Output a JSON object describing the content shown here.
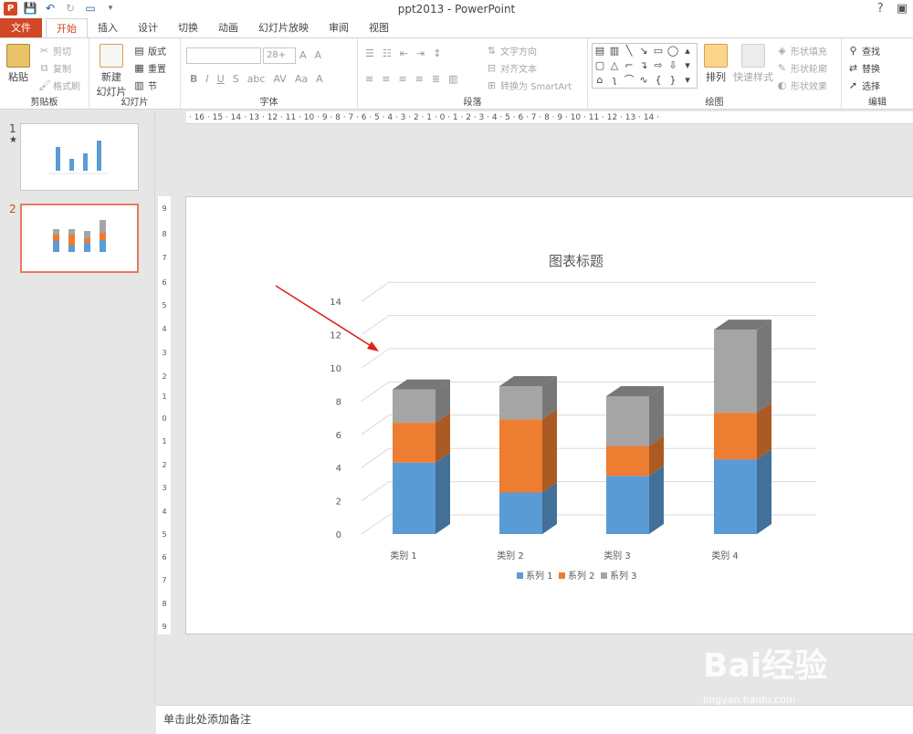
{
  "title_bar": {
    "app_title": "ppt2013 - PowerPoint",
    "logo_letter": "P",
    "help": "?"
  },
  "tabs": [
    "文件",
    "开始",
    "插入",
    "设计",
    "切换",
    "动画",
    "幻灯片放映",
    "审阅",
    "视图"
  ],
  "ribbon": {
    "clipboard": {
      "label": "剪贴板",
      "paste": "粘贴",
      "cut": "剪切",
      "copy": "复制",
      "format_painter": "格式刷"
    },
    "slides": {
      "label": "幻灯片",
      "new_slide_1": "新建",
      "new_slide_2": "幻灯片",
      "layout": "版式",
      "reset": "重置",
      "section": "节"
    },
    "font": {
      "label": "字体",
      "size": "28+"
    },
    "paragraph": {
      "label": "段落",
      "text_direction": "文字方向",
      "align_text": "对齐文本",
      "smartart": "转换为 SmartArt"
    },
    "drawing": {
      "label": "绘图",
      "arrange": "排列",
      "quick_styles": "快速样式",
      "shape_fill": "形状填充",
      "shape_outline": "形状轮廓",
      "shape_effects": "形状效果"
    },
    "editing": {
      "label": "编辑",
      "find": "查找",
      "replace": "替换",
      "select": "选择"
    }
  },
  "thumbnails": [
    {
      "number": "1",
      "marker": "★"
    },
    {
      "number": "2",
      "marker": ""
    }
  ],
  "notes_placeholder": "单击此处添加备注",
  "watermark": {
    "brand": "Bai",
    "brand_cn": "经验",
    "url": "jingyan.baidu.com"
  },
  "colors": {
    "accent": "#d24726",
    "series1": "#5b9bd5",
    "series2": "#ed7d31",
    "series3": "#a5a5a5",
    "arrow": "#e0201b"
  },
  "chart_data": {
    "type": "bar",
    "stacked": true,
    "three_d": true,
    "title": "图表标题",
    "categories": [
      "类别 1",
      "类别 2",
      "类别 3",
      "类别 4"
    ],
    "series": [
      {
        "name": "系列 1",
        "values": [
          4.3,
          2.5,
          3.5,
          4.5
        ],
        "color": "#5b9bd5"
      },
      {
        "name": "系列 2",
        "values": [
          2.4,
          4.4,
          1.8,
          2.8
        ],
        "color": "#ed7d31"
      },
      {
        "name": "系列 3",
        "values": [
          2,
          2,
          3,
          5
        ],
        "color": "#a5a5a5"
      }
    ],
    "yticks": [
      "0",
      "2",
      "4",
      "6",
      "8",
      "10",
      "12",
      "14"
    ],
    "ylim": [
      0,
      14
    ],
    "grid": true,
    "legend_position": "bottom"
  }
}
